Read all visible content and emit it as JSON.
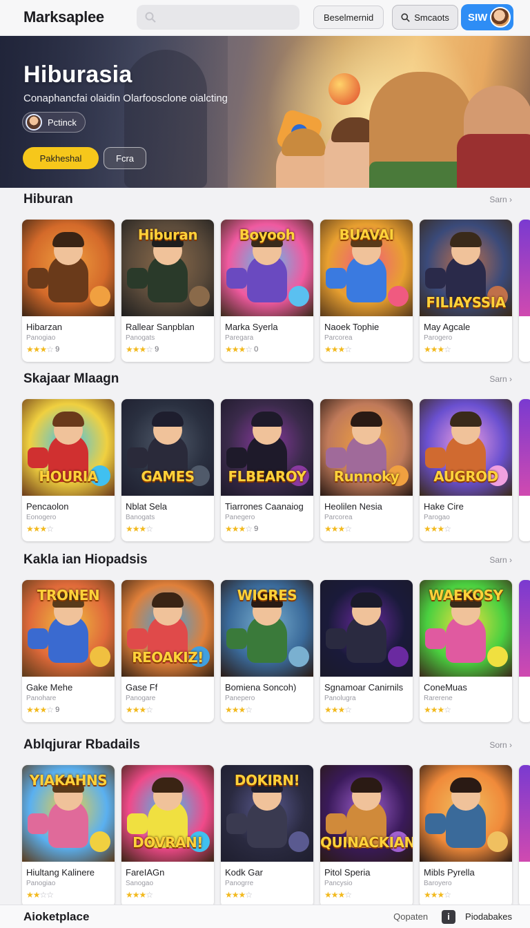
{
  "header": {
    "brand": "Marksaplee",
    "search_placeholder": "",
    "btn_plain": "Beselmernid",
    "btn_search": "Smcaots",
    "account_initials": "SIW"
  },
  "hero": {
    "title": "Hiburasia",
    "subtitle": "Conaphancfai olaidin Olarfoosclone oialcting",
    "pill_label": "Pctinck",
    "primary_button": "Pakheshal",
    "secondary_button": "Fcra"
  },
  "sections": [
    {
      "title": "Hiburan",
      "more": "Sarn ›",
      "items": [
        {
          "name": "Hibarzan",
          "category": "Panogiao",
          "stars": 3,
          "rating": "9"
        },
        {
          "name": "Rallear Sanpblan",
          "category": "Panogats",
          "stars": 3,
          "rating": "9"
        },
        {
          "name": "Marka Syerla",
          "category": "Paregara",
          "stars": 3,
          "rating": "0"
        },
        {
          "name": "Naoek Tophie",
          "category": "Parcorea",
          "stars": 3,
          "rating": ""
        },
        {
          "name": "May Agcale",
          "category": "Parogero",
          "stars": 3,
          "rating": ""
        }
      ]
    },
    {
      "title": "Skajaar Mlaagn",
      "more": "Sarn ›",
      "items": [
        {
          "name": "Pencaolon",
          "category": "Eonogero",
          "stars": 3,
          "rating": ""
        },
        {
          "name": "Nblat Sela",
          "category": "Banogats",
          "stars": 3,
          "rating": ""
        },
        {
          "name": "Tiarrones Caanaiog",
          "category": "Panegero",
          "stars": 3,
          "rating": "9"
        },
        {
          "name": "Heolilen Nesia",
          "category": "Parcorea",
          "stars": 3,
          "rating": ""
        },
        {
          "name": "Hake Cire",
          "category": "Parogao",
          "stars": 3,
          "rating": ""
        }
      ]
    },
    {
      "title": "Kakla ian Hiopadsis",
      "more": "Sarn ›",
      "items": [
        {
          "name": "Gake Mehe",
          "category": "Panohare",
          "stars": 3,
          "rating": "9"
        },
        {
          "name": "Gase Ff",
          "category": "Panogare",
          "stars": 3,
          "rating": ""
        },
        {
          "name": "Bomiena Soncoh)",
          "category": "Panepero",
          "stars": 3,
          "rating": ""
        },
        {
          "name": "Sgnamoar Canirnils",
          "category": "Panolugra",
          "stars": 3,
          "rating": ""
        },
        {
          "name": "ConeMuas",
          "category": "Rarerene",
          "stars": 3,
          "rating": ""
        }
      ]
    },
    {
      "title": "Ablqjurar Rbadails",
      "more": "Sorn ›",
      "items": [
        {
          "name": "Hiultang Kalinere",
          "category": "Panogiao",
          "stars": 2,
          "rating": ""
        },
        {
          "name": "FareIAGn",
          "category": "Sanogao",
          "stars": 3,
          "rating": ""
        },
        {
          "name": "Kodk Gar",
          "category": "Panogrre",
          "stars": 3,
          "rating": ""
        },
        {
          "name": "Pitol Speria",
          "category": "Pancysio",
          "stars": 3,
          "rating": ""
        },
        {
          "name": "Mibls Pyrella",
          "category": "Baroyero",
          "stars": 3,
          "rating": ""
        }
      ]
    }
  ],
  "footer": {
    "title": "Aioketplace",
    "link": "Qopaten",
    "icon_glyph": "i",
    "upload": "Piodabakes"
  },
  "colors": {
    "accent_yellow": "#f6c71b",
    "account_blue": "#2e8df5"
  }
}
